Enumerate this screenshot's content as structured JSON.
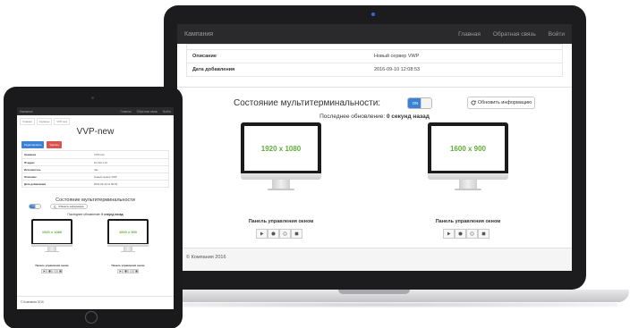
{
  "laptop": {
    "nav": {
      "brand": "Кампания",
      "links": [
        "Главная",
        "Обратная связь",
        "Войти"
      ]
    },
    "details": [
      {
        "key": "Описание",
        "value": "Новый сервер VWP"
      },
      {
        "key": "Дата добавления",
        "value": "2016-09-10 12:08:53"
      }
    ],
    "status": {
      "title": "Состояние мультитерминальности:",
      "toggle_label": "ON",
      "refresh_label": "Обновить информацию",
      "updated_prefix": "Последнее обновление:",
      "updated_value": "0 секунд назад"
    },
    "monitors": [
      {
        "resolution": "1920 x 1080",
        "panel_title": "Панель управления окном"
      },
      {
        "resolution": "1600 x 900",
        "panel_title": "Панель управления окном"
      }
    ],
    "footer": "© Компания 2016"
  },
  "tablet": {
    "nav": {
      "brand": "Кампания",
      "links": [
        "Главная",
        "Обратная связь",
        "Войти"
      ]
    },
    "crumbs": [
      "Главная",
      "Серверы",
      "VVP-new"
    ],
    "title": "VVP-new",
    "buttons": {
      "edit": "Редактировать",
      "delete": "Удалить"
    },
    "details": [
      {
        "key": "Название",
        "value": "VVP-new"
      },
      {
        "key": "IP-адрес",
        "value": "10.134.1.10"
      },
      {
        "key": "Исполнитель",
        "value": "Vas"
      },
      {
        "key": "Описание",
        "value": "Новый сервер VWP"
      },
      {
        "key": "Дата добавления",
        "value": "2016-09-10 12:08:53"
      }
    ],
    "status": {
      "title": "Состояние мультитерминальности",
      "toggle_label": "ON",
      "refresh_label": "Обновить информацию",
      "updated_prefix": "Последнее обновление:",
      "updated_value": "0 секунд назад"
    },
    "monitors": [
      {
        "resolution": "1920 x 1080",
        "panel_title": "Панель управления окном"
      },
      {
        "resolution": "1600 x 900",
        "panel_title": "Панель управления окном"
      }
    ],
    "footer": "© Компания 2016"
  },
  "icons": {
    "refresh": "refresh-icon",
    "controls": [
      "play-icon",
      "record-icon",
      "settings-icon",
      "stop-icon"
    ]
  },
  "colors": {
    "accent": "#3a82d6",
    "danger": "#d9534f",
    "resolution_text": "#5fae3a"
  }
}
